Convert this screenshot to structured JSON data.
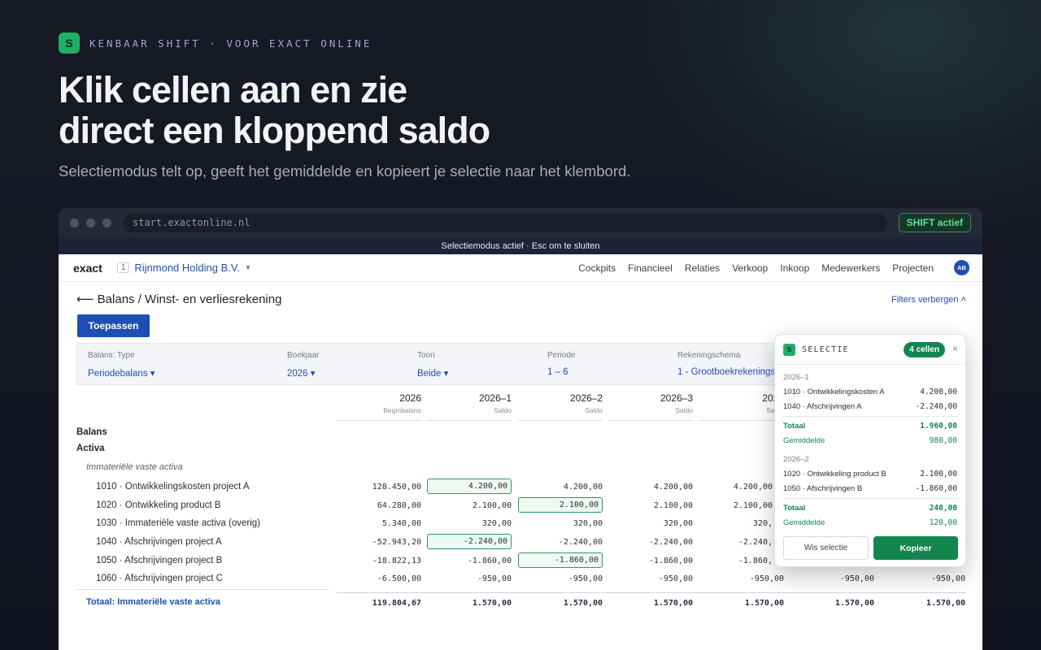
{
  "hero": {
    "brand": "KENBAAR SHIFT · VOOR EXACT ONLINE",
    "logo_letter": "S",
    "title_line1": "Klik cellen aan en zie",
    "title_line2": "direct een kloppend saldo",
    "subtitle": "Selectiemodus telt op, geeft het gemiddelde en kopieert je selectie naar het klembord."
  },
  "browser": {
    "url": "start.exactonline.nl",
    "shift_badge": "SHIFT actief",
    "mode_bar": "Selectiemodus actief · Esc om te sluiten"
  },
  "app": {
    "logo": "exact",
    "company_number": "1",
    "company": "Rijnmond Holding B.V.",
    "nav": [
      "Cockpits",
      "Financieel",
      "Relaties",
      "Verkoop",
      "Inkoop",
      "Medewerkers",
      "Projecten"
    ],
    "avatar": "AB",
    "page_title": "⟵ Balans / Winst- en verliesrekening",
    "filters_toggle": "Filters verbergen ˄",
    "apply_button": "Toepassen",
    "filters": [
      {
        "label": "Balans: Type",
        "value": "Periodebalans ▾"
      },
      {
        "label": "Boekjaar",
        "value": "2026 ▾"
      },
      {
        "label": "Toon",
        "value": "Beide ▾"
      },
      {
        "label": "Periode",
        "value": "1 – 6"
      },
      {
        "label": "Rekeningschema",
        "value": "1 - Grootboekrekeningschema"
      }
    ],
    "columns": [
      {
        "year": "2026",
        "sub": "Beginbalans"
      },
      {
        "year": "2026–1",
        "sub": "Saldo"
      },
      {
        "year": "2026–2",
        "sub": "Saldo"
      },
      {
        "year": "2026–3",
        "sub": "Saldo"
      },
      {
        "year": "2026",
        "sub": "Saldo"
      }
    ],
    "section_balans": "Balans",
    "section_activa": "Activa",
    "subsection": "Immateriële vaste activa",
    "rows": [
      {
        "label": "1010 · Ontwikkelingskosten project A",
        "values": [
          "128.450,00",
          "4.200,00",
          "4.200,00",
          "4.200,00",
          "4.200,00",
          "",
          ""
        ]
      },
      {
        "label": "1020 · Ontwikkeling product B",
        "values": [
          "64.280,00",
          "2.100,00",
          "2.100,00",
          "2.100,00",
          "2.100,00",
          "",
          ""
        ]
      },
      {
        "label": "1030 · Immateriële vaste activa (overig)",
        "values": [
          "5.340,00",
          "320,00",
          "320,00",
          "320,00",
          "320,",
          "",
          ""
        ]
      },
      {
        "label": "1040 · Afschrijvingen project A",
        "values": [
          "-52.943,20",
          "-2.240,00",
          "-2.240,00",
          "-2.240,00",
          "-2.240,",
          "",
          ""
        ]
      },
      {
        "label": "1050 · Afschrijvingen project B",
        "values": [
          "-18.822,13",
          "-1.860,00",
          "-1.860,00",
          "-1.860,00",
          "-1.860,",
          "",
          ""
        ]
      },
      {
        "label": "1060 · Afschrijvingen project C",
        "values": [
          "-6.500,00",
          "-950,00",
          "-950,00",
          "-950,00",
          "-950,00",
          "-950,00",
          "-950,00"
        ]
      }
    ],
    "total_label": "Totaal: Immateriële vaste activa",
    "total_values": [
      "119.804,67",
      "1.570,00",
      "1.570,00",
      "1.570,00",
      "1.570,00",
      "1.570,00",
      "1.570,00"
    ]
  },
  "selection": {
    "title": "SELECTIE",
    "logo_letter": "S",
    "count": "4 cellen",
    "close": "×",
    "groups": [
      {
        "name": "2026–1",
        "items": [
          {
            "label": "1010 · Ontwikkelingskosten A",
            "value": "4.200,00"
          },
          {
            "label": "1040 · Afschrijvingen A",
            "value": "-2.240,00"
          }
        ],
        "total_label": "Totaal",
        "total": "1.960,00",
        "avg_label": "Gemiddelde",
        "avg": "980,00"
      },
      {
        "name": "2026–2",
        "items": [
          {
            "label": "1020 · Ontwikkeling product B",
            "value": "2.100,00"
          },
          {
            "label": "1050 · Afschrijvingen B",
            "value": "-1.860,00"
          }
        ],
        "total_label": "Totaal",
        "total": "240,00",
        "avg_label": "Gemiddelde",
        "avg": "120,00"
      }
    ],
    "clear_button": "Wis selectie",
    "copy_button": "Kopieer"
  },
  "colors": {
    "accent_green": "#13864f",
    "link_blue": "#1e4fb5",
    "background": "#141623"
  }
}
